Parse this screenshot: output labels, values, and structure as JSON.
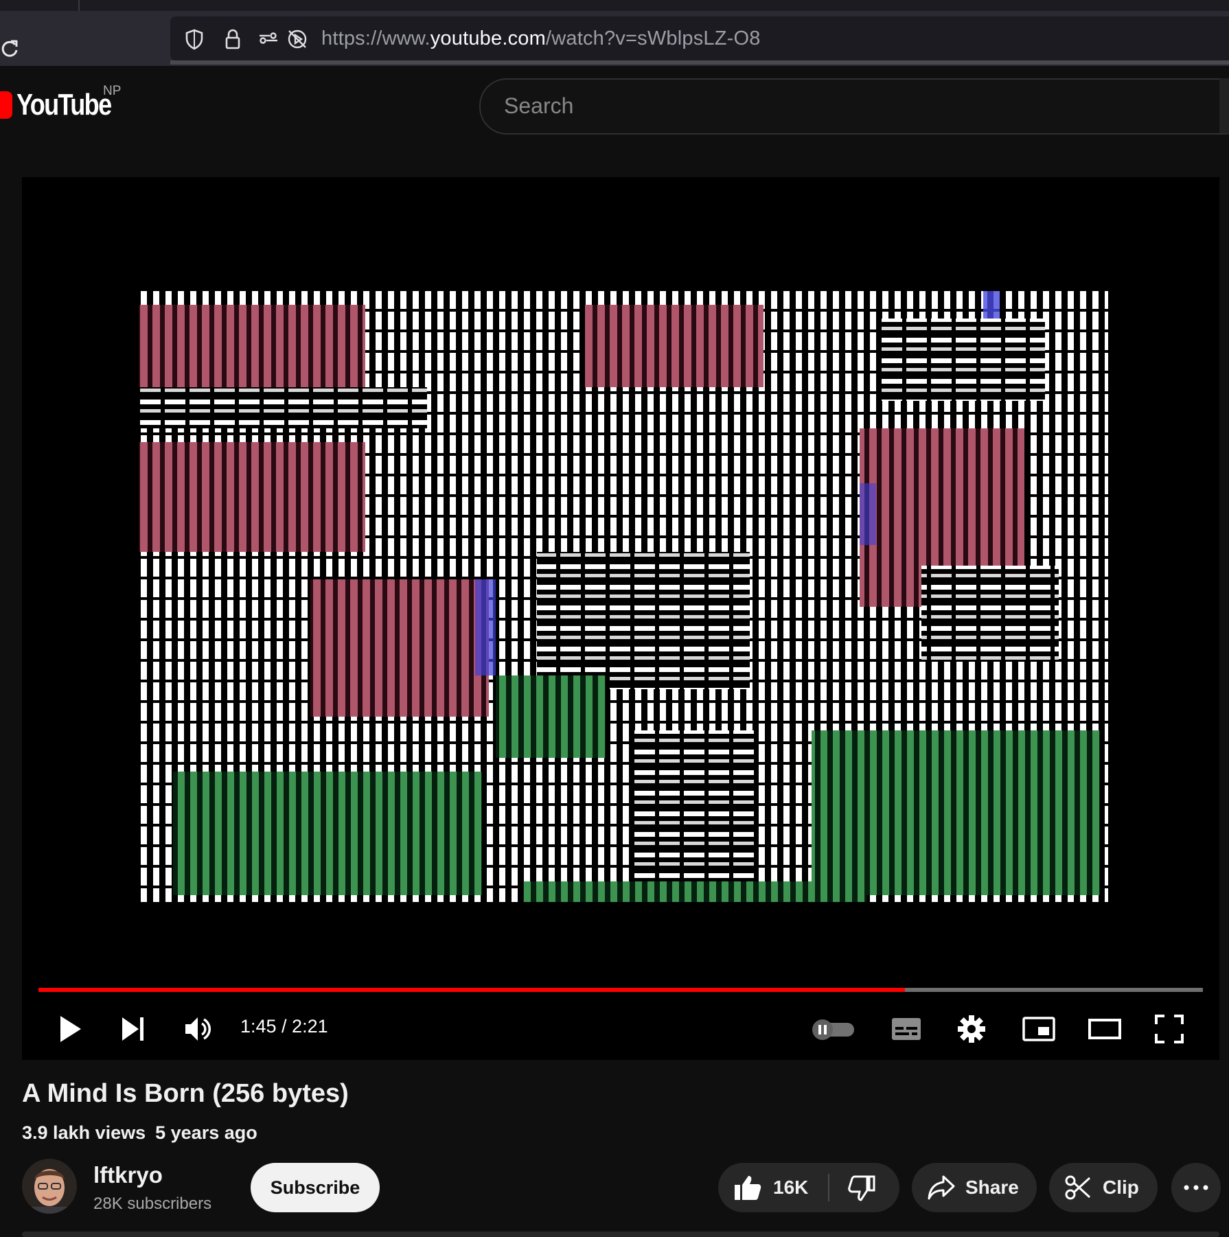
{
  "browser": {
    "url_prefix": "https://www.",
    "url_domain": "youtube.com",
    "url_path": "/watch?v=sWblpsLZ-O8"
  },
  "header": {
    "logo_text": "YouTube",
    "country_code": "NP",
    "search_placeholder": "Search"
  },
  "player": {
    "time_display": "1:45 / 2:21",
    "progress_fraction": 0.744
  },
  "video": {
    "title": "A Mind Is Born (256 bytes)",
    "views": "3.9 lakh views",
    "age": "5 years ago"
  },
  "channel": {
    "name": "lftkryo",
    "subscribers": "28K subscribers",
    "subscribe_label": "Subscribe"
  },
  "actions": {
    "likes": "16K",
    "share_label": "Share",
    "clip_label": "Clip"
  },
  "colors": {
    "accent": "#ff0000",
    "background": "#0f0f0f",
    "pill": "#272727"
  }
}
